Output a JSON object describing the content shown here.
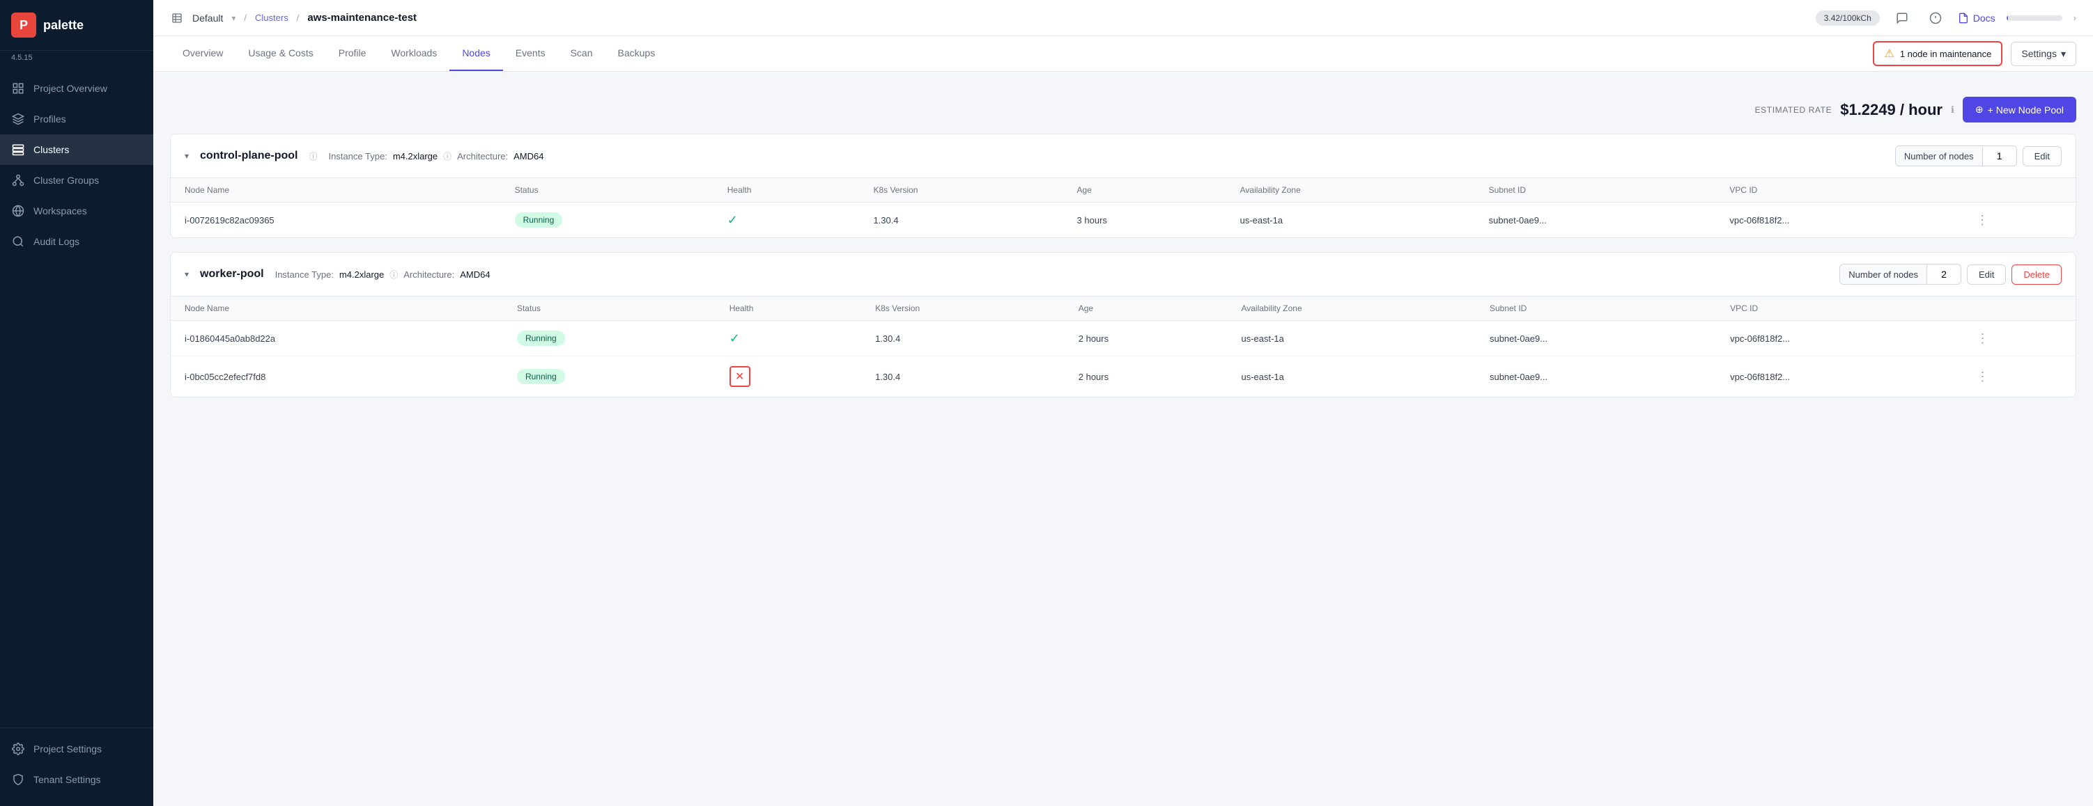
{
  "app": {
    "version": "4.5.15"
  },
  "sidebar": {
    "logo_letter": "P",
    "logo_name": "palette",
    "items": [
      {
        "id": "project-overview",
        "label": "Project Overview",
        "icon": "grid"
      },
      {
        "id": "profiles",
        "label": "Profiles",
        "icon": "layers"
      },
      {
        "id": "clusters",
        "label": "Clusters",
        "icon": "server",
        "active": true
      },
      {
        "id": "cluster-groups",
        "label": "Cluster Groups",
        "icon": "cluster"
      },
      {
        "id": "workspaces",
        "label": "Workspaces",
        "icon": "workspace"
      },
      {
        "id": "audit-logs",
        "label": "Audit Logs",
        "icon": "audit"
      }
    ],
    "bottom_items": [
      {
        "id": "project-settings",
        "label": "Project Settings",
        "icon": "settings"
      },
      {
        "id": "tenant-settings",
        "label": "Tenant Settings",
        "icon": "tenant"
      }
    ]
  },
  "topbar": {
    "workspace": "Default",
    "breadcrumb_clusters": "Clusters",
    "breadcrumb_current": "aws-maintenance-test",
    "credit": "3.42/100kCh",
    "progress_pct": 3.42,
    "docs_label": "Docs"
  },
  "tabs": {
    "items": [
      {
        "id": "overview",
        "label": "Overview"
      },
      {
        "id": "usage-costs",
        "label": "Usage & Costs"
      },
      {
        "id": "profile",
        "label": "Profile"
      },
      {
        "id": "workloads",
        "label": "Workloads"
      },
      {
        "id": "nodes",
        "label": "Nodes",
        "active": true
      },
      {
        "id": "events",
        "label": "Events"
      },
      {
        "id": "scan",
        "label": "Scan"
      },
      {
        "id": "backups",
        "label": "Backups"
      }
    ],
    "maintenance_alert": "1 node in maintenance",
    "settings_label": "Settings"
  },
  "content": {
    "estimated_rate_label": "ESTIMATED RATE",
    "estimated_rate_value": "$1.2249 / hour",
    "new_pool_btn": "+ New Node Pool",
    "control_plane_pool": {
      "name": "control-plane-pool",
      "instance_type_label": "Instance Type:",
      "instance_type": "m4.2xlarge",
      "architecture_label": "Architecture:",
      "architecture": "AMD64",
      "node_count_label": "Number of nodes",
      "node_count": "1",
      "edit_label": "Edit",
      "columns": [
        "Node Name",
        "Status",
        "Health",
        "K8s Version",
        "Age",
        "Availability Zone",
        "Subnet ID",
        "VPC ID"
      ],
      "rows": [
        {
          "name": "i-0072619c82ac09365",
          "status": "Running",
          "health": "ok",
          "k8s_version": "1.30.4",
          "age": "3 hours",
          "az": "us-east-1a",
          "subnet": "subnet-0ae9...",
          "vpc": "vpc-06f818f2..."
        }
      ]
    },
    "worker_pool": {
      "name": "worker-pool",
      "instance_type_label": "Instance Type:",
      "instance_type": "m4.2xlarge",
      "architecture_label": "Architecture:",
      "architecture": "AMD64",
      "node_count_label": "Number of nodes",
      "node_count": "2",
      "edit_label": "Edit",
      "delete_label": "Delete",
      "columns": [
        "Node Name",
        "Status",
        "Health",
        "K8s Version",
        "Age",
        "Availability Zone",
        "Subnet ID",
        "VPC ID"
      ],
      "rows": [
        {
          "name": "i-01860445a0ab8d22a",
          "status": "Running",
          "health": "ok",
          "k8s_version": "1.30.4",
          "age": "2 hours",
          "az": "us-east-1a",
          "subnet": "subnet-0ae9...",
          "vpc": "vpc-06f818f2..."
        },
        {
          "name": "i-0bc05cc2efecf7fd8",
          "status": "Running",
          "health": "maintenance",
          "k8s_version": "1.30.4",
          "age": "2 hours",
          "az": "us-east-1a",
          "subnet": "subnet-0ae9...",
          "vpc": "vpc-06f818f2..."
        }
      ]
    }
  }
}
